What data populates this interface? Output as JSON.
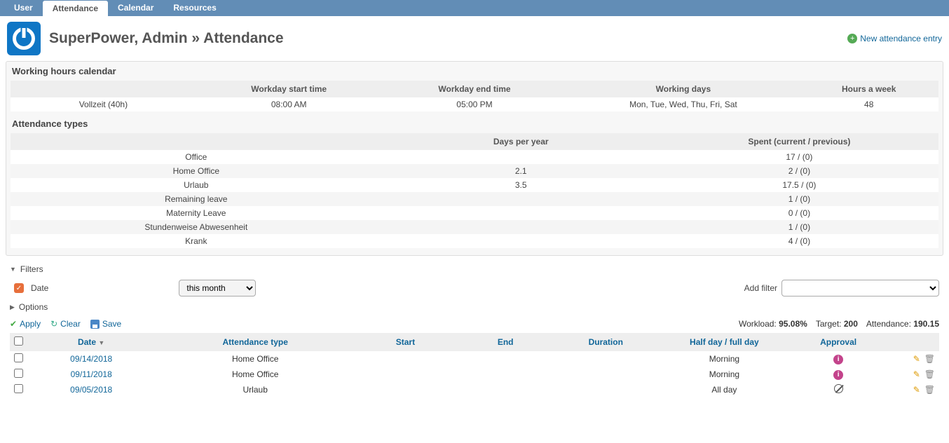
{
  "nav": {
    "tabs": [
      "User",
      "Attendance",
      "Calendar",
      "Resources"
    ],
    "active": 1
  },
  "header": {
    "title": "SuperPower, Admin » Attendance",
    "new_entry": "New attendance entry"
  },
  "wh": {
    "title": "Working hours calendar",
    "cols": [
      "",
      "Workday start time",
      "Workday end time",
      "Working days",
      "Hours a week"
    ],
    "rows": [
      {
        "name": "Vollzeit (40h)",
        "start": "08:00 AM",
        "end": "05:00 PM",
        "days": "Mon, Tue, Wed, Thu, Fri, Sat",
        "hours": "48"
      }
    ]
  },
  "at": {
    "title": "Attendance types",
    "cols": [
      "",
      "Days per year",
      "Spent (current / previous)"
    ],
    "rows": [
      {
        "name": "Office",
        "dpy": "",
        "spent": "17 / (0)"
      },
      {
        "name": "Home Office",
        "dpy": "2.1",
        "spent": "2 / (0)"
      },
      {
        "name": "Urlaub",
        "dpy": "3.5",
        "spent": "17.5 / (0)"
      },
      {
        "name": "Remaining leave",
        "dpy": "",
        "spent": "1 / (0)"
      },
      {
        "name": "Maternity Leave",
        "dpy": "",
        "spent": "0 / (0)"
      },
      {
        "name": "Stundenweise Abwesenheit",
        "dpy": "",
        "spent": "1 / (0)"
      },
      {
        "name": "Krank",
        "dpy": "",
        "spent": "4 / (0)"
      }
    ]
  },
  "filters": {
    "label": "Filters",
    "date_label": "Date",
    "date_value": "this month",
    "options_label": "Options",
    "add_filter_label": "Add filter",
    "add_filter_value": ""
  },
  "actions": {
    "apply": "Apply",
    "clear": "Clear",
    "save": "Save"
  },
  "stats": {
    "workload_l": "Workload:",
    "workload_v": "95.08%",
    "target_l": "Target:",
    "target_v": "200",
    "attendance_l": "Attendance:",
    "attendance_v": "190.15"
  },
  "list": {
    "cols": [
      "Date",
      "Attendance type",
      "Start",
      "End",
      "Duration",
      "Half day / full day",
      "Approval"
    ],
    "rows": [
      {
        "date": "09/14/2018",
        "type": "Home Office",
        "start": "",
        "end": "",
        "dur": "",
        "half": "Morning",
        "approval": "info"
      },
      {
        "date": "09/11/2018",
        "type": "Home Office",
        "start": "",
        "end": "",
        "dur": "",
        "half": "Morning",
        "approval": "info"
      },
      {
        "date": "09/05/2018",
        "type": "Urlaub",
        "start": "",
        "end": "",
        "dur": "",
        "half": "All day",
        "approval": "ban"
      }
    ]
  }
}
